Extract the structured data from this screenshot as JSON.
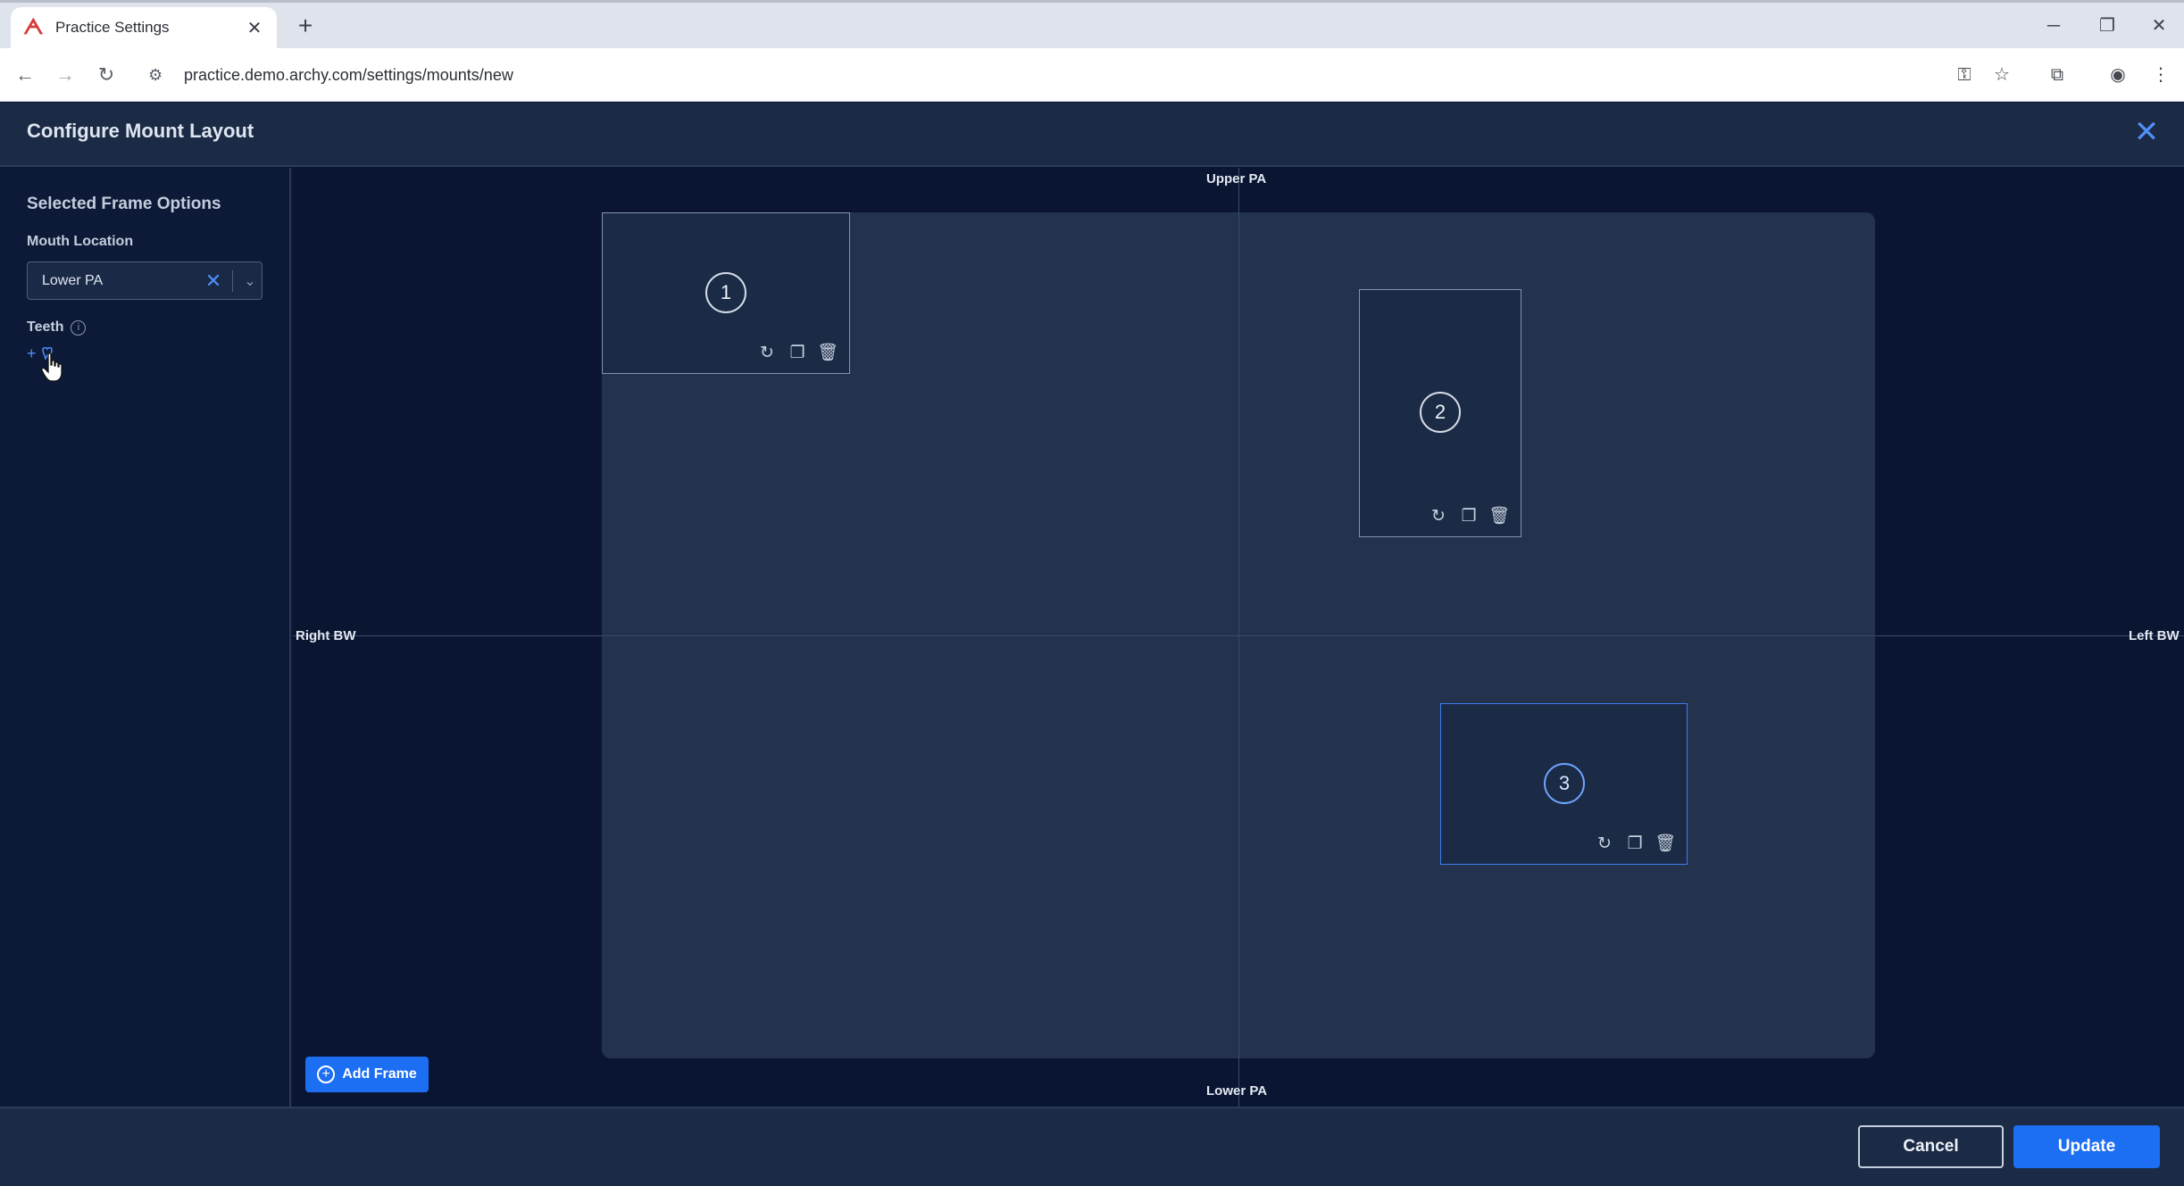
{
  "browser": {
    "tab_title": "Practice Settings",
    "tab_close": "✕",
    "new_tab": "+",
    "url": "practice.demo.archy.com/settings/mounts/new",
    "window": {
      "minimize": "─",
      "restore": "❐",
      "close": "✕"
    }
  },
  "app": {
    "title": "Configure Mount Layout",
    "close_icon": "✕"
  },
  "sidebar": {
    "heading": "Selected Frame Options",
    "mouth_location_label": "Mouth Location",
    "mouth_location_value": "Lower PA",
    "teeth_label": "Teeth",
    "add_tooth": "+"
  },
  "canvas": {
    "label_top": "Upper PA",
    "label_bottom": "Lower PA",
    "label_left": "Right BW",
    "label_right": "Left BW",
    "frames": [
      {
        "number": "1",
        "selected": false
      },
      {
        "number": "2",
        "selected": false
      },
      {
        "number": "3",
        "selected": true
      }
    ],
    "add_frame_label": "Add Frame"
  },
  "footer": {
    "cancel_label": "Cancel",
    "update_label": "Update"
  },
  "colors": {
    "accent": "#1c6ef2",
    "background": "#0b1733",
    "panel": "#1b2a45",
    "mount": "#23334d"
  }
}
